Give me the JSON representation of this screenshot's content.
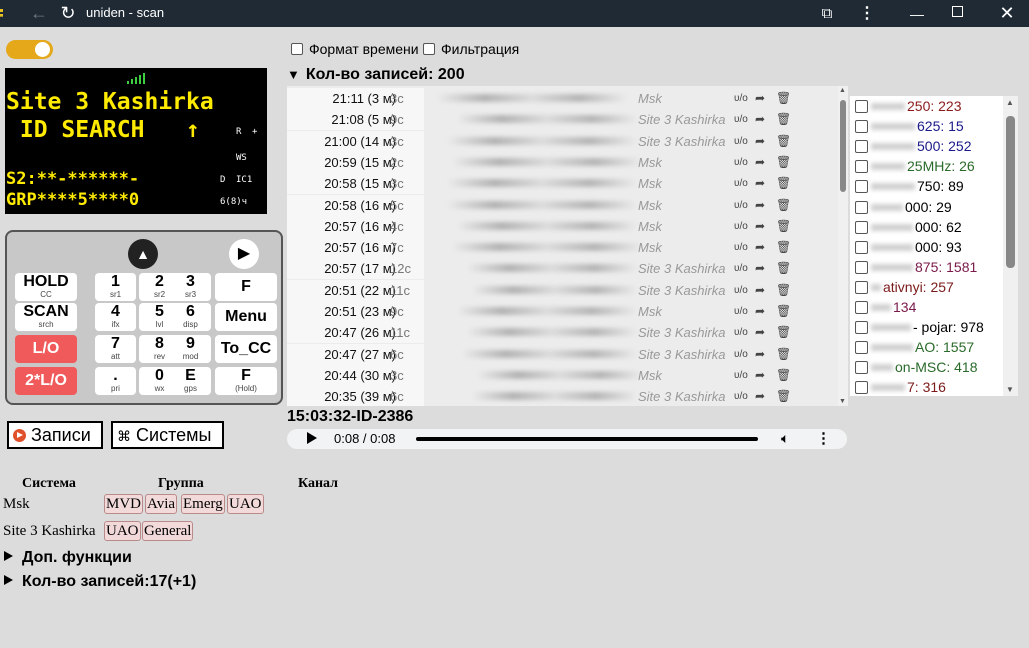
{
  "window": {
    "title": "uniden - scan"
  },
  "display": {
    "line1": "Site 3 Kashirka",
    "line2": " ID SEARCH   ↑",
    "line3": "S2:**-******-",
    "line4": "GRP****5****0",
    "flag_r": "R",
    "flag_plus": "+",
    "flag_ws": "WS",
    "flag_d": "D",
    "flag_ic1": "IC1",
    "flag_68": "6(8)ч"
  },
  "keypad": {
    "keys": [
      {
        "label": "HOLD",
        "sub": "CC"
      },
      {
        "label": "1",
        "sub": "sr1"
      },
      {
        "label": "2",
        "sub": "sr2"
      },
      {
        "label": "3",
        "sub": "sr3"
      },
      {
        "label": "F",
        "sub": ""
      },
      {
        "label": "SCAN",
        "sub": "srch"
      },
      {
        "label": "4",
        "sub": "ifx"
      },
      {
        "label": "5",
        "sub": "lvl"
      },
      {
        "label": "6",
        "sub": "disp"
      },
      {
        "label": "Menu",
        "sub": ""
      },
      {
        "label": "L/O",
        "sub": ""
      },
      {
        "label": "7",
        "sub": "att"
      },
      {
        "label": "8",
        "sub": "rev"
      },
      {
        "label": "9",
        "sub": "mod"
      },
      {
        "label": "To_CC",
        "sub": ""
      },
      {
        "label": "2*L/O",
        "sub": ""
      },
      {
        "label": ".",
        "sub": "pri"
      },
      {
        "label": "0",
        "sub": "wx"
      },
      {
        "label": "E",
        "sub": "gps"
      },
      {
        "label": "F",
        "sub": "(Hold)"
      }
    ]
  },
  "buttons": {
    "records": "Записи",
    "systems": "Системы"
  },
  "options": {
    "time_format": "Формат времени",
    "filter": "Фильтрация"
  },
  "records": {
    "count_title": "Кол-во записей: 200",
    "rows": [
      {
        "time": "21:11 (3 м)",
        "dur": "3c",
        "sys": "Msk"
      },
      {
        "time": "21:08 (5 м)",
        "dur": "9c",
        "sys": "Site 3 Kashirka"
      },
      {
        "time": "21:00 (14 м)",
        "dur": "3c",
        "sys": "Site 3 Kashirka"
      },
      {
        "time": "20:59 (15 м)",
        "dur": "2c",
        "sys": "Msk"
      },
      {
        "time": "20:58 (15 м)",
        "dur": "3c",
        "sys": "Msk"
      },
      {
        "time": "20:58 (16 м)",
        "dur": "5c",
        "sys": "Msk"
      },
      {
        "time": "20:57 (16 м)",
        "dur": "4c",
        "sys": "Msk"
      },
      {
        "time": "20:57 (16 м)",
        "dur": "7c",
        "sys": "Msk"
      },
      {
        "time": "20:57 (17 м)",
        "dur": "12c",
        "sys": "Site 3 Kashirka"
      },
      {
        "time": "20:51 (22 м)",
        "dur": "11c",
        "sys": "Site 3 Kashirka"
      },
      {
        "time": "20:51 (23 м)",
        "dur": "9c",
        "sys": "Msk"
      },
      {
        "time": "20:47 (26 м)",
        "dur": "11c",
        "sys": "Site 3 Kashirka"
      },
      {
        "time": "20:47 (27 м)",
        "dur": "6c",
        "sys": "Site 3 Kashirka"
      },
      {
        "time": "20:44 (30 м)",
        "dur": "3c",
        "sys": "Msk"
      },
      {
        "time": "20:35 (39 м)",
        "dur": "6c",
        "sys": "Site 3 Kashirka"
      }
    ],
    "row_icon_text": "ᴜ/o"
  },
  "current": {
    "label": "15:03:32-ID-2386",
    "time": "0:08 / 0:08"
  },
  "talkgroups": [
    {
      "text": "250: 223",
      "color": "#8b1a1a"
    },
    {
      "text": "625: 15",
      "color": "#1a1a8b"
    },
    {
      "text": "500: 252",
      "color": "#1a1a8b"
    },
    {
      "text": "25MHz: 26",
      "color": "#2a6a2a"
    },
    {
      "text": "750: 89",
      "color": "#000000"
    },
    {
      "text": "000: 29",
      "color": "#000000"
    },
    {
      "text": "000: 62",
      "color": "#000000"
    },
    {
      "text": "000: 93",
      "color": "#000000"
    },
    {
      "text": "875: 1581",
      "color": "#7a1a4a"
    },
    {
      "text": "ativnyi: 257",
      "color": "#7a1a1a"
    },
    {
      "text": "134",
      "color": "#7a1a4a"
    },
    {
      "text": "- pojar: 978",
      "color": "#000000"
    },
    {
      "text": "AO: 1557",
      "color": "#2a6a2a"
    },
    {
      "text": "on-MSC: 418",
      "color": "#2a6a2a"
    },
    {
      "text": "7: 316",
      "color": "#7a1a1a"
    }
  ],
  "systems_table": {
    "headers": {
      "system": "Система",
      "group": "Группа",
      "channel": "Канал"
    },
    "rows": [
      {
        "system": "Msk",
        "groups": [
          "MVD",
          "Avia",
          "Emerg",
          "UAO"
        ]
      },
      {
        "system": "Site 3 Kashirka",
        "groups": [
          "UAO",
          "General"
        ]
      }
    ]
  },
  "sections": {
    "extra": "Доп. функции",
    "records_count": "Кол-во записей:17(+1)"
  }
}
